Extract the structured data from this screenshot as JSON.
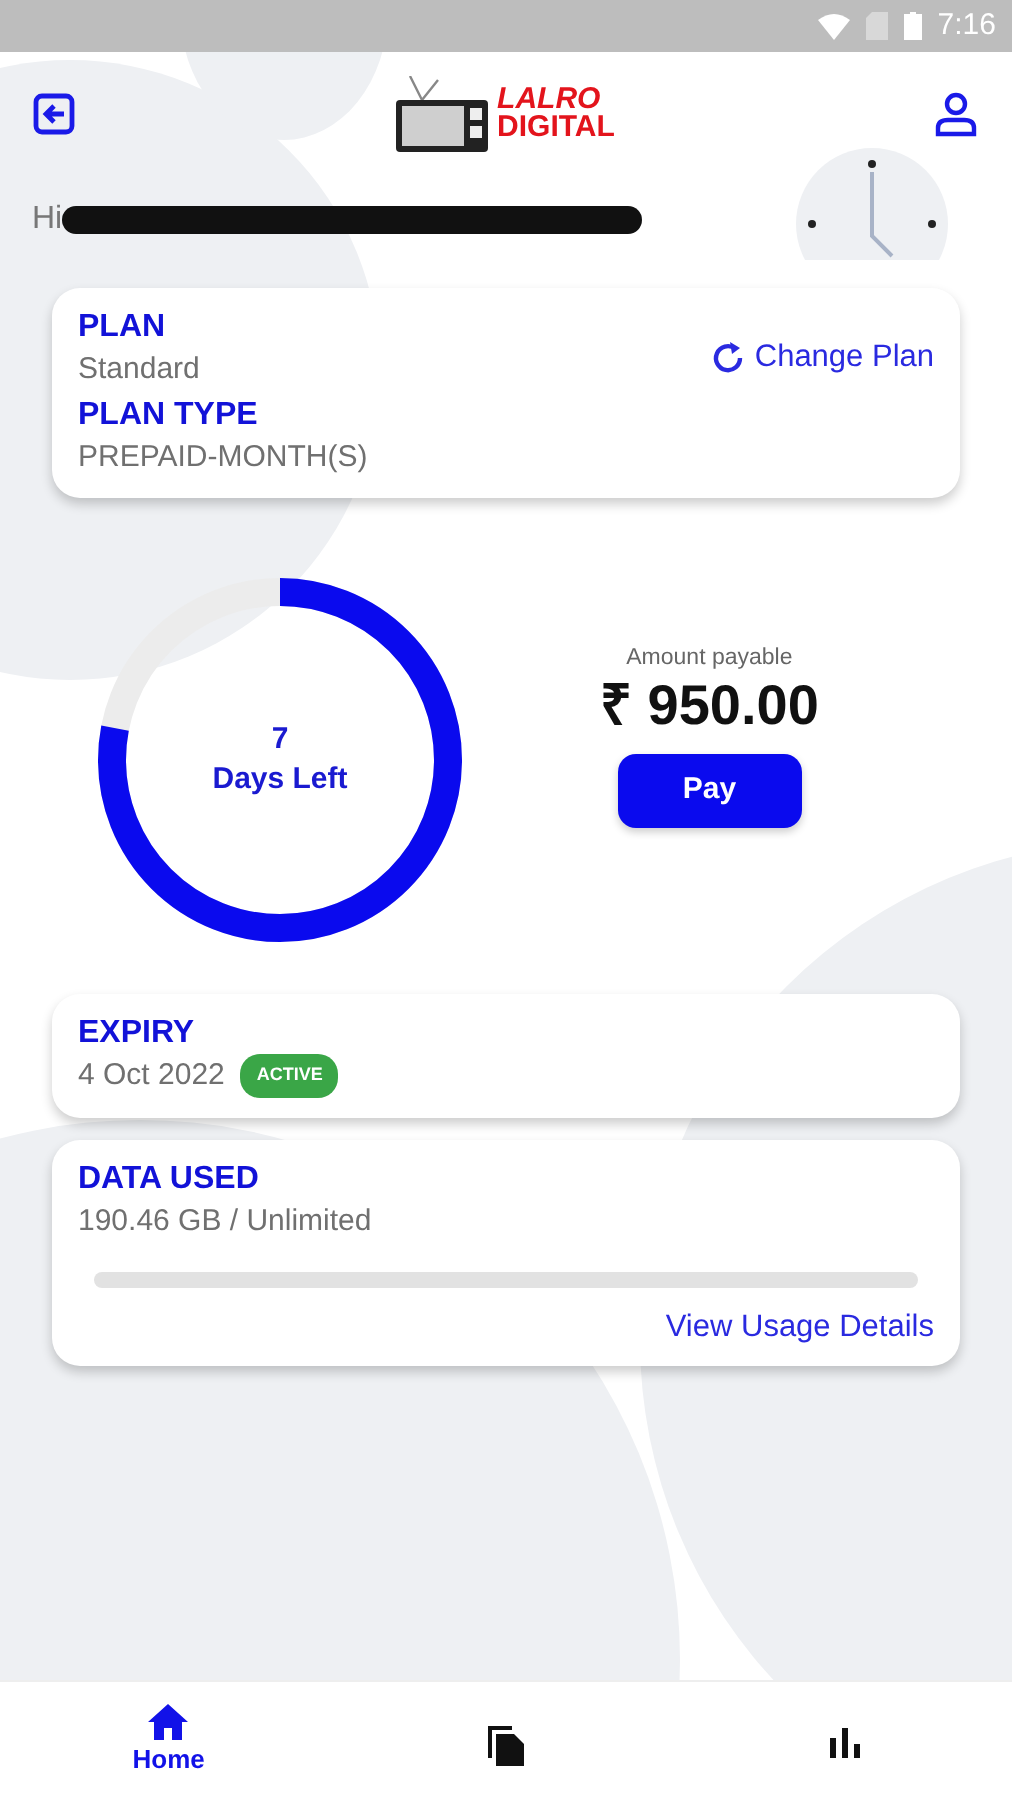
{
  "status_bar": {
    "time": "7:16"
  },
  "header": {
    "logo": {
      "line_1": "LALRO",
      "line_2": "DIGITAL"
    }
  },
  "greeting": {
    "text": "Hi",
    "redacted": true
  },
  "plan_card": {
    "plan_label": "PLAN",
    "plan_value": "Standard",
    "change_link": "Change Plan",
    "type_label": "PLAN TYPE",
    "type_value": "PREPAID-MONTH(S)"
  },
  "days_ring": {
    "level": 0.78,
    "number": "7",
    "caption": "Days Left"
  },
  "payment": {
    "label": "Amount payable",
    "amount": "₹ 950.00",
    "button": "Pay"
  },
  "expiry_card": {
    "label": "EXPIRY",
    "date": "4 Oct 2022",
    "badge": "ACTIVE",
    "color": "#3aa647"
  },
  "data_card": {
    "label": "DATA USED",
    "usage": "190.46 GB / Unlimited",
    "level": 0,
    "link": "View Usage Details"
  },
  "bottom_nav": [
    {
      "kind": "home",
      "label": "Home",
      "selected": true
    },
    {
      "kind": "documents",
      "selected": false
    },
    {
      "kind": "stats",
      "selected": false
    }
  ]
}
